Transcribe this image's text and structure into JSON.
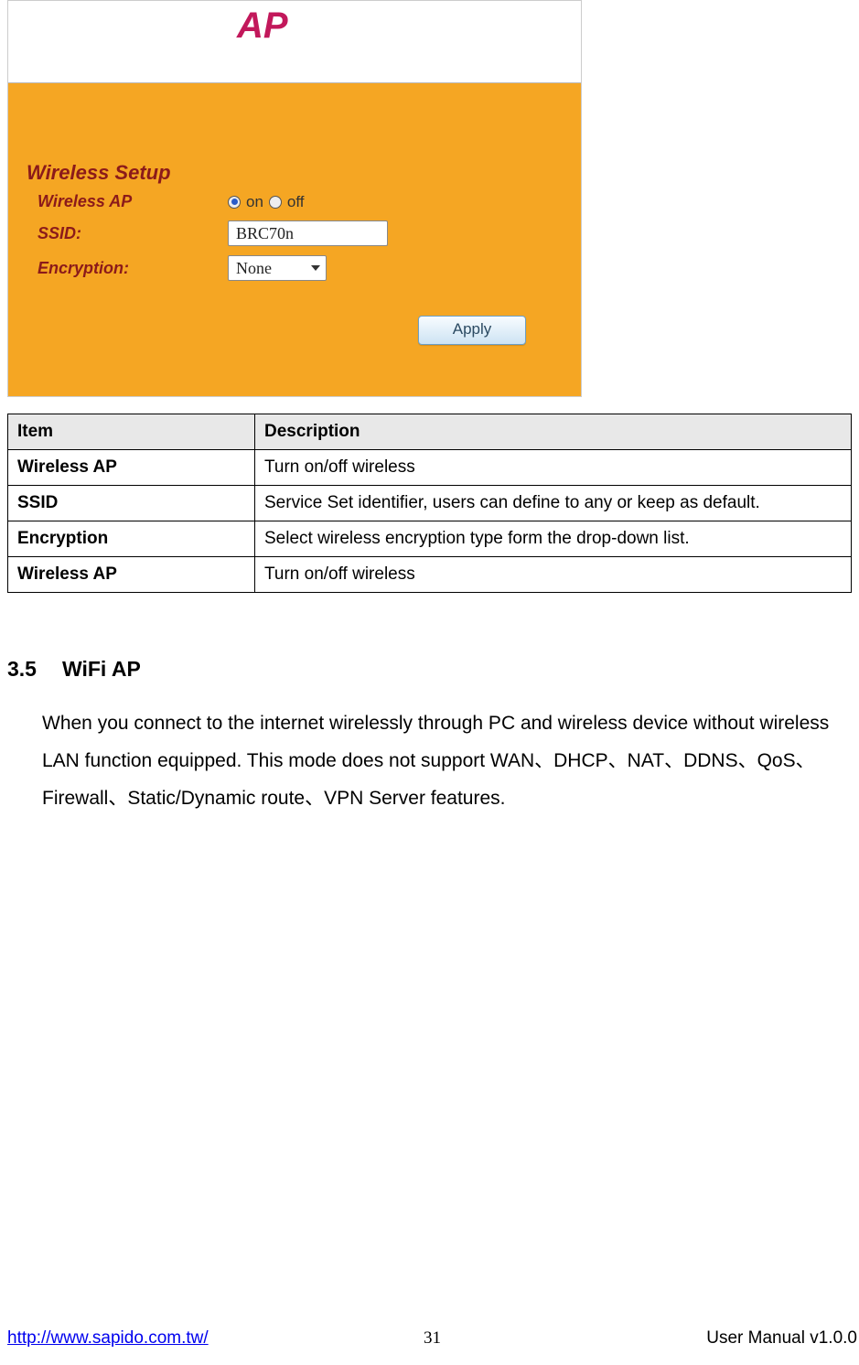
{
  "router_ui": {
    "header_title": "AP",
    "section_title": "Wireless Setup",
    "rows": {
      "wireless_ap": {
        "label": "Wireless AP",
        "on_label": "on",
        "off_label": "off"
      },
      "ssid": {
        "label": "SSID:",
        "value": "BRC70n"
      },
      "encryption": {
        "label": "Encryption:",
        "value": "None"
      }
    },
    "apply_label": "Apply"
  },
  "desc_table": {
    "headers": {
      "item": "Item",
      "desc": "Description"
    },
    "rows": [
      {
        "item": "Wireless AP",
        "desc": "Turn on/off wireless"
      },
      {
        "item": "SSID",
        "desc": "Service Set identifier, users can define to any or keep as default."
      },
      {
        "item": "Encryption",
        "desc": "Select wireless encryption type form the drop-down list."
      },
      {
        "item": "Wireless AP",
        "desc": "Turn on/off wireless"
      }
    ]
  },
  "section": {
    "number": "3.5",
    "title": "WiFi AP",
    "body": "When you connect to the internet wirelessly through PC and wireless device without wireless LAN function equipped. This mode does not support WAN、DHCP、NAT、DDNS、QoS、Firewall、Static/Dynamic route、VPN Server features."
  },
  "footer": {
    "url": "http://www.sapido.com.tw/",
    "page": "31",
    "manual": "User Manual v1.0.0"
  }
}
